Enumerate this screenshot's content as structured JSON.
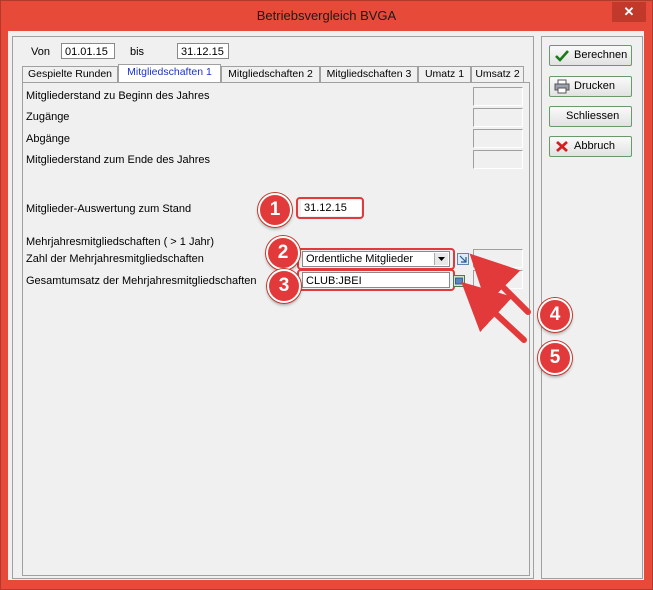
{
  "window": {
    "title": "Betriebsvergleich BVGA",
    "close_glyph": "✕"
  },
  "period": {
    "from_label": "Von",
    "from_value": "01.01.15",
    "to_label": "bis",
    "to_value": "31.12.15"
  },
  "tabs": [
    {
      "label": "Gespielte Runden",
      "active": false
    },
    {
      "label": "Mitgliedschaften 1",
      "active": true
    },
    {
      "label": "Mitgliedschaften 2",
      "active": false
    },
    {
      "label": "Mitgliedschaften 3",
      "active": false
    },
    {
      "label": "Umatz 1",
      "active": false
    },
    {
      "label": "Umsatz 2",
      "active": false
    }
  ],
  "fields": {
    "start_label": "Mitgliederstand zu Beginn des Jahres",
    "zugaenge_label": "Zugänge",
    "abgaenge_label": "Abgänge",
    "end_label": "Mitgliederstand zum Ende des Jahres",
    "auswertung_label": "Mitglieder-Auswertung zum Stand",
    "auswertung_value": "31.12.15",
    "mehrjahres_label": "Mehrjahresmitgliedschaften ( > 1 Jahr)",
    "zahl_label": "Zahl der Mehrjahresmitgliedschaften",
    "zahl_select": "Ordentliche Mitglieder",
    "umsatz_label": "Gesamtumsatz der Mehrjahresmitgliedschaften",
    "umsatz_value": "CLUB:JBEI"
  },
  "buttons": {
    "berechnen": "Berechnen",
    "drucken": "Drucken",
    "schliessen": "Schliessen",
    "abbruch": "Abbruch"
  },
  "badges": [
    "1",
    "2",
    "3",
    "4",
    "5"
  ],
  "colors": {
    "annotation": "#e23a3a",
    "active_tab_text": "#1a33cc",
    "title_bar": "#e84a3a"
  },
  "icons": {
    "berechnen": "checkmark-icon",
    "drucken": "printer-icon",
    "abbruch": "x-icon",
    "combo": "chevron-down-icon"
  }
}
